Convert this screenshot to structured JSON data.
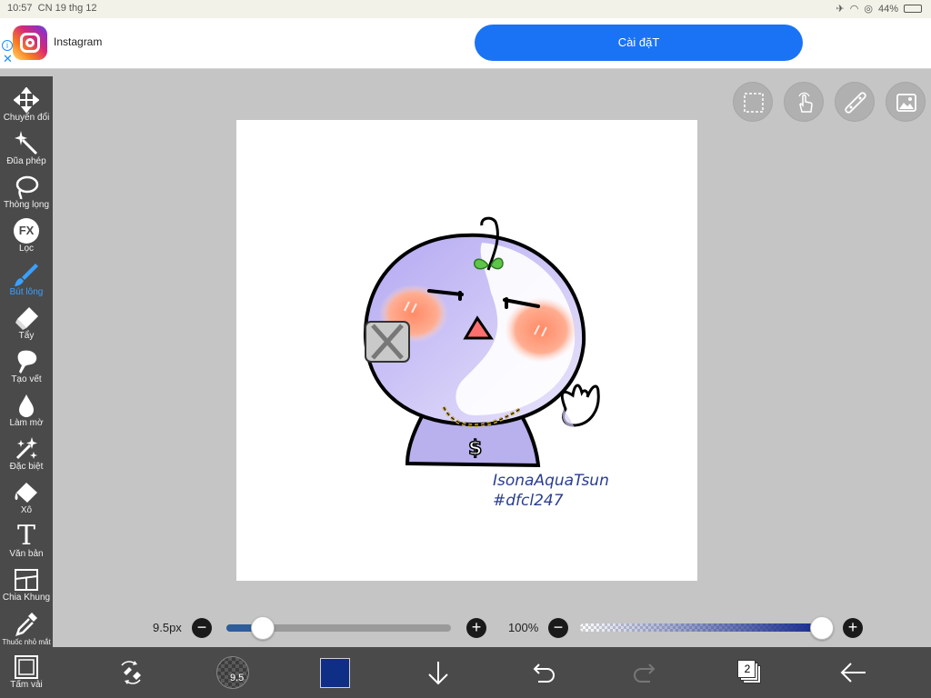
{
  "status": {
    "time": "10:57",
    "date": "CN 19 thg 12",
    "battery": "44%"
  },
  "ad": {
    "app_name": "Instagram",
    "button_label": "Cài đặT"
  },
  "tools": [
    {
      "id": "transform",
      "label": "Chuyển đổi",
      "icon": "move-icon"
    },
    {
      "id": "magic-wand",
      "label": "Đũa phép",
      "icon": "magic-wand-icon"
    },
    {
      "id": "lasso",
      "label": "Thòng lọng",
      "icon": "lasso-icon"
    },
    {
      "id": "filter",
      "label": "Lọc",
      "icon": "fx-icon",
      "icon_text": "FX"
    },
    {
      "id": "brush",
      "label": "Bút lông",
      "icon": "brush-icon",
      "active": true
    },
    {
      "id": "eraser",
      "label": "Tẩy",
      "icon": "eraser-icon"
    },
    {
      "id": "smudge",
      "label": "Tạo vết",
      "icon": "smudge-icon"
    },
    {
      "id": "blur",
      "label": "Làm mờ",
      "icon": "blur-drop-icon"
    },
    {
      "id": "special",
      "label": "Đặc biệt",
      "icon": "sparkle-icon"
    },
    {
      "id": "fill",
      "label": "Xô",
      "icon": "bucket-icon"
    },
    {
      "id": "text",
      "label": "Văn bản",
      "icon": "text-icon",
      "icon_text": "T"
    },
    {
      "id": "frame",
      "label": "Chia Khung",
      "icon": "frame-divider-icon"
    },
    {
      "id": "eyedropper",
      "label": "Thuốc nhỏ mắt",
      "icon": "eyedropper-icon"
    },
    {
      "id": "canvas",
      "label": "Tấm vải",
      "icon": "canvas-icon"
    }
  ],
  "artwork": {
    "signature_line1": "IsonaAquaTsun",
    "signature_line2": "#dfcl247"
  },
  "brush": {
    "size_label": "9.5px",
    "size_fraction": 0.16,
    "preview_value": "9.5"
  },
  "opacity": {
    "label": "100%",
    "value": 1.0
  },
  "colors": {
    "current": "#0f2f86",
    "accent": "#3aa0ff",
    "ad_button": "#1a73f5"
  },
  "layers": {
    "count": "2"
  }
}
